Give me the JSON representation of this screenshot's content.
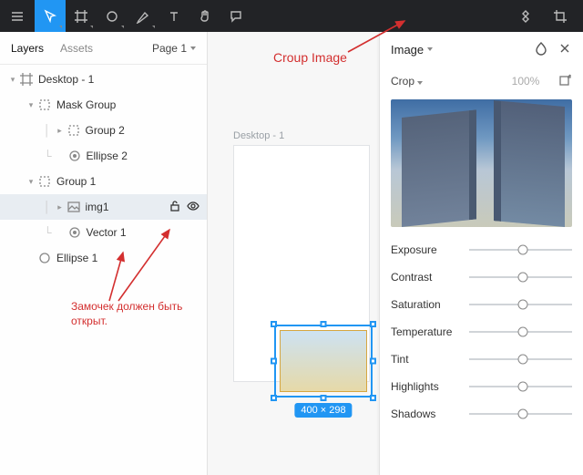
{
  "toolbar": {
    "buttons": [
      "menu",
      "move",
      "artboard",
      "grid",
      "shape",
      "pen",
      "text",
      "hand",
      "comment"
    ],
    "right": [
      "components",
      "crop"
    ]
  },
  "side": {
    "tabs": {
      "layers": "Layers",
      "assets": "Assets",
      "page": "Page 1"
    },
    "tree": {
      "root": {
        "label": "Desktop - 1"
      },
      "mask": {
        "label": "Mask Group"
      },
      "g2": {
        "label": "Group 2"
      },
      "e2": {
        "label": "Ellipse 2"
      },
      "g1": {
        "label": "Group 1"
      },
      "img1": {
        "label": "img1"
      },
      "v1": {
        "label": "Vector 1"
      },
      "e1": {
        "label": "Ellipse 1"
      }
    }
  },
  "canvas": {
    "artboard_label": "Desktop - 1",
    "size_badge": "400 × 298"
  },
  "annotations": {
    "crop": "Croup Image",
    "lock": "Замочек должен быть открыт."
  },
  "inspector": {
    "title": "Image",
    "fill_mode": "Crop",
    "opacity": "100%",
    "sliders": {
      "exposure": {
        "label": "Exposure",
        "pos": 0.52
      },
      "contrast": {
        "label": "Contrast",
        "pos": 0.52
      },
      "saturation": {
        "label": "Saturation",
        "pos": 0.52
      },
      "temperature": {
        "label": "Temperature",
        "pos": 0.52
      },
      "tint": {
        "label": "Tint",
        "pos": 0.52
      },
      "highlights": {
        "label": "Highlights",
        "pos": 0.52
      },
      "shadows": {
        "label": "Shadows",
        "pos": 0.52
      }
    }
  }
}
